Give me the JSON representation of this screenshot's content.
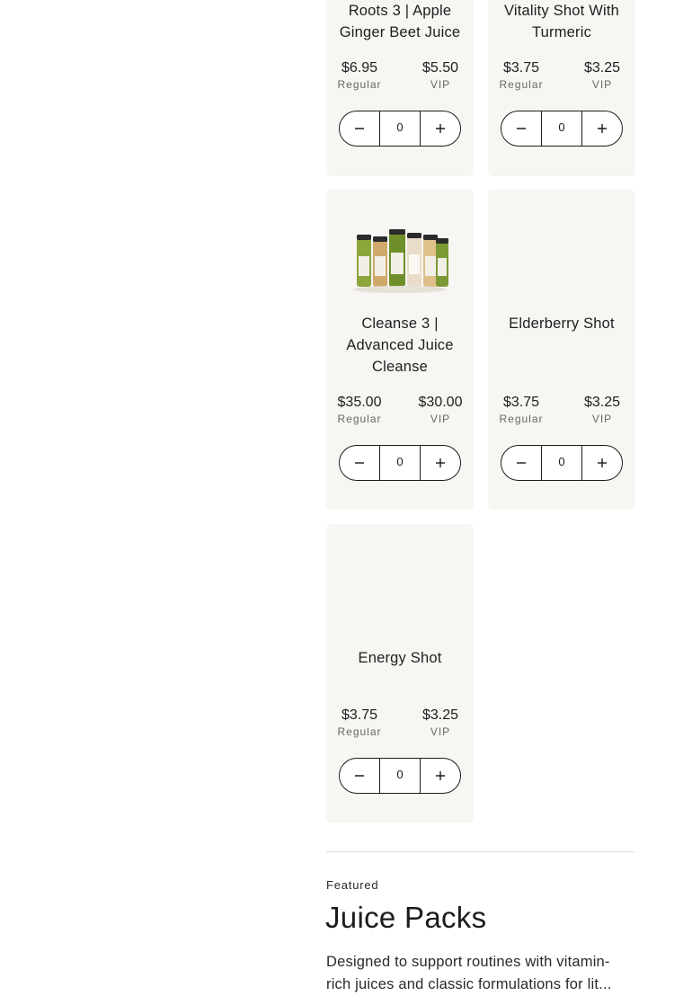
{
  "products": [
    {
      "name": "Roots 3 | Apple Ginger Beet Juice",
      "regular_price": "$6.95",
      "regular_label": "Regular",
      "vip_price": "$5.50",
      "vip_label": "VIP",
      "quantity": "0",
      "has_image": false
    },
    {
      "name": "Vitality Shot With Turmeric",
      "regular_price": "$3.75",
      "regular_label": "Regular",
      "vip_price": "$3.25",
      "vip_label": "VIP",
      "quantity": "0",
      "has_image": false
    },
    {
      "name": "Cleanse 3 | Advanced Juice Cleanse",
      "regular_price": "$35.00",
      "regular_label": "Regular",
      "vip_price": "$30.00",
      "vip_label": "VIP",
      "quantity": "0",
      "has_image": true
    },
    {
      "name": "Elderberry Shot",
      "regular_price": "$3.75",
      "regular_label": "Regular",
      "vip_price": "$3.25",
      "vip_label": "VIP",
      "quantity": "0",
      "has_image": false
    },
    {
      "name": "Energy Shot",
      "regular_price": "$3.75",
      "regular_label": "Regular",
      "vip_price": "$3.25",
      "vip_label": "VIP",
      "quantity": "0",
      "has_image": false
    }
  ],
  "stepper_icons": {
    "decrement": "minus-icon",
    "increment": "plus-icon"
  },
  "featured_section": {
    "eyebrow": "Featured",
    "title": "Juice Packs",
    "description": "Designed to support routines with vitamin-rich juices and classic formulations for lit..."
  },
  "colors": {
    "card_background": "#f8f6f3",
    "text": "#1c1c1c",
    "muted_text": "#666666",
    "divider": "#dedede"
  }
}
